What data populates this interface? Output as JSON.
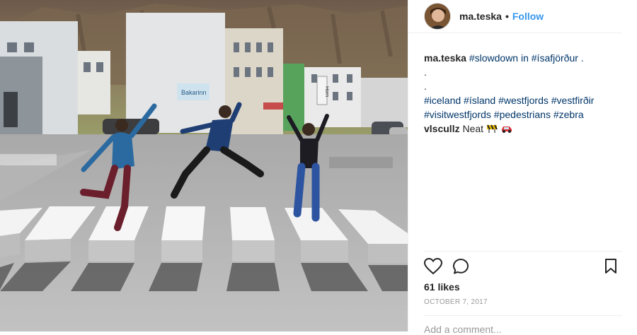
{
  "post": {
    "username": "ma.teska",
    "separator": "•",
    "follow_label": "Follow",
    "image_alt_signs": {
      "shop_sign": "Bakarinn",
      "building_sign": "Horn"
    }
  },
  "caption": {
    "username": "ma.teska",
    "line1_tags": "#slowdown in #ísafjörður .",
    "dots": [
      ".",
      "."
    ],
    "line2": "#iceland #ísland #westfjords #vestfirðir",
    "line3": "#visitwestfjords #pedestrians #zebra"
  },
  "comment": {
    "username": "vlscullz",
    "text": "Neat",
    "emoji": [
      "construction-sign",
      "red-car"
    ]
  },
  "actions": {
    "icons": [
      "heart-icon",
      "comment-icon",
      "bookmark-icon"
    ]
  },
  "likes": "61 likes",
  "date": "OCTOBER 7, 2017",
  "add_comment_placeholder": "Add a comment...",
  "colors": {
    "link": "#3897f0",
    "hashtag": "#003569",
    "muted": "#999999"
  }
}
